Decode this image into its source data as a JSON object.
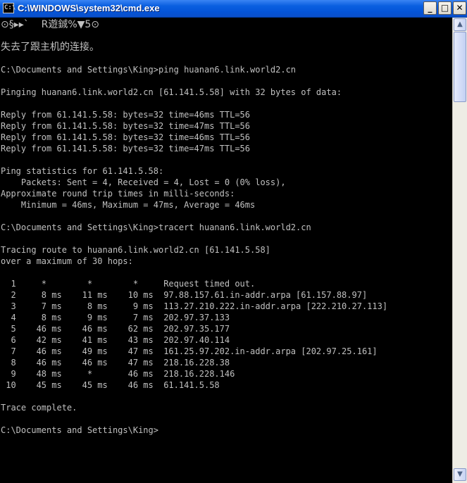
{
  "window": {
    "title": "C:\\WINDOWS\\system32\\cmd.exe",
    "icon": "cmd-icon",
    "icon_text": "C:\\",
    "controls": {
      "minimize": "_",
      "maximize": "□",
      "close": "✕"
    }
  },
  "console": {
    "lines": [
      "⊙§▸▸`    R遊鋮%▼5⊙",
      "",
      "失去了跟主机的连接。",
      "",
      "C:\\Documents and Settings\\King>ping huanan6.link.world2.cn",
      "",
      "Pinging huanan6.link.world2.cn [61.141.5.58] with 32 bytes of data:",
      "",
      "Reply from 61.141.5.58: bytes=32 time=46ms TTL=56",
      "Reply from 61.141.5.58: bytes=32 time=47ms TTL=56",
      "Reply from 61.141.5.58: bytes=32 time=46ms TTL=56",
      "Reply from 61.141.5.58: bytes=32 time=47ms TTL=56",
      "",
      "Ping statistics for 61.141.5.58:",
      "    Packets: Sent = 4, Received = 4, Lost = 0 (0% loss),",
      "Approximate round trip times in milli-seconds:",
      "    Minimum = 46ms, Maximum = 47ms, Average = 46ms",
      "",
      "C:\\Documents and Settings\\King>tracert huanan6.link.world2.cn",
      "",
      "Tracing route to huanan6.link.world2.cn [61.141.5.58]",
      "over a maximum of 30 hops:",
      "",
      "  1     *        *        *     Request timed out.",
      "  2     8 ms    11 ms    10 ms  97.88.157.61.in-addr.arpa [61.157.88.97]",
      "  3     7 ms     8 ms     9 ms  113.27.210.222.in-addr.arpa [222.210.27.113]",
      "  4     8 ms     9 ms     7 ms  202.97.37.133",
      "  5    46 ms    46 ms    62 ms  202.97.35.177",
      "  6    42 ms    41 ms    43 ms  202.97.40.114",
      "  7    46 ms    49 ms    47 ms  161.25.97.202.in-addr.arpa [202.97.25.161]",
      "  8    46 ms    46 ms    47 ms  218.16.228.38",
      "  9    48 ms     *       46 ms  218.16.228.146",
      " 10    45 ms    45 ms    46 ms  61.141.5.58",
      "",
      "Trace complete.",
      "",
      "C:\\Documents and Settings\\King>"
    ]
  },
  "scrollbar": {
    "up_arrow": "▲",
    "down_arrow": "▼"
  }
}
